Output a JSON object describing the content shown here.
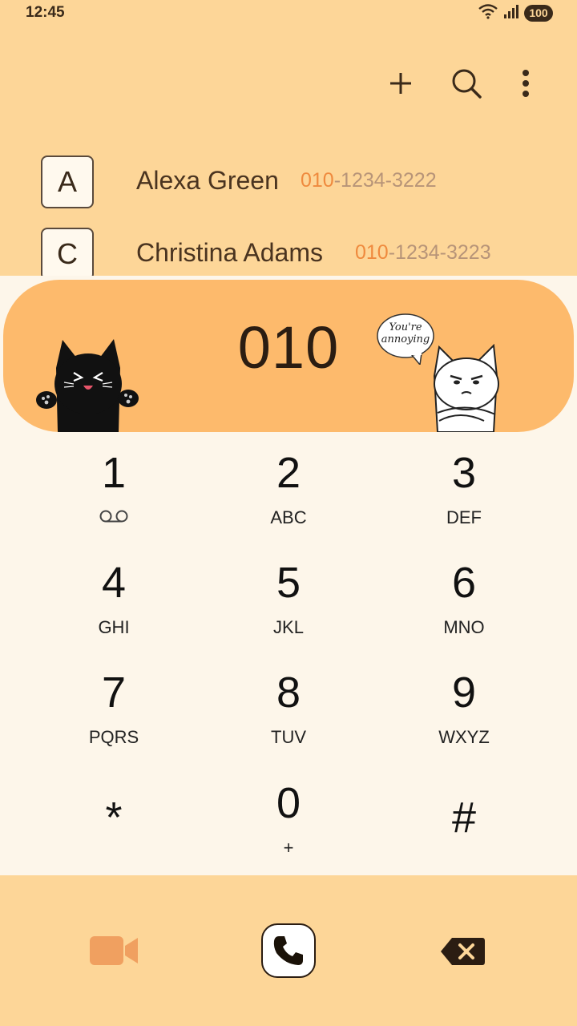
{
  "status_bar": {
    "time": "12:45",
    "battery": "100",
    "wifi_icon": "wifi-icon",
    "signal_icon": "signal-icon"
  },
  "toolbar": {
    "add_icon": "plus-icon",
    "search_icon": "search-icon",
    "more_icon": "more-vertical-icon"
  },
  "contacts": [
    {
      "letter": "A",
      "name": "Alexa Green",
      "number_match": "010",
      "number_rest": "-1234-3222"
    },
    {
      "letter": "C",
      "name": "Christina Adams",
      "number_match": "010",
      "number_rest": "-1234-3223"
    }
  ],
  "dialer": {
    "number": "010",
    "speech_bubble": [
      "You're",
      "annoying"
    ],
    "keys": [
      {
        "digit": "1",
        "letters": "",
        "icon": "voicemail-icon"
      },
      {
        "digit": "2",
        "letters": "ABC"
      },
      {
        "digit": "3",
        "letters": "DEF"
      },
      {
        "digit": "4",
        "letters": "GHI"
      },
      {
        "digit": "5",
        "letters": "JKL"
      },
      {
        "digit": "6",
        "letters": "MNO"
      },
      {
        "digit": "7",
        "letters": "PQRS"
      },
      {
        "digit": "8",
        "letters": "TUV"
      },
      {
        "digit": "9",
        "letters": "WXYZ"
      },
      {
        "digit": "*",
        "letters": ""
      },
      {
        "digit": "0",
        "letters": "+"
      },
      {
        "digit": "#",
        "letters": ""
      }
    ]
  },
  "bottom_bar": {
    "video_icon": "video-call-icon",
    "call_icon": "phone-icon",
    "delete_icon": "backspace-icon"
  },
  "colors": {
    "background": "#fdd698",
    "banner": "#fdba6c",
    "keypad": "#fdf6ea",
    "match_accent": "#ef8a3e"
  }
}
